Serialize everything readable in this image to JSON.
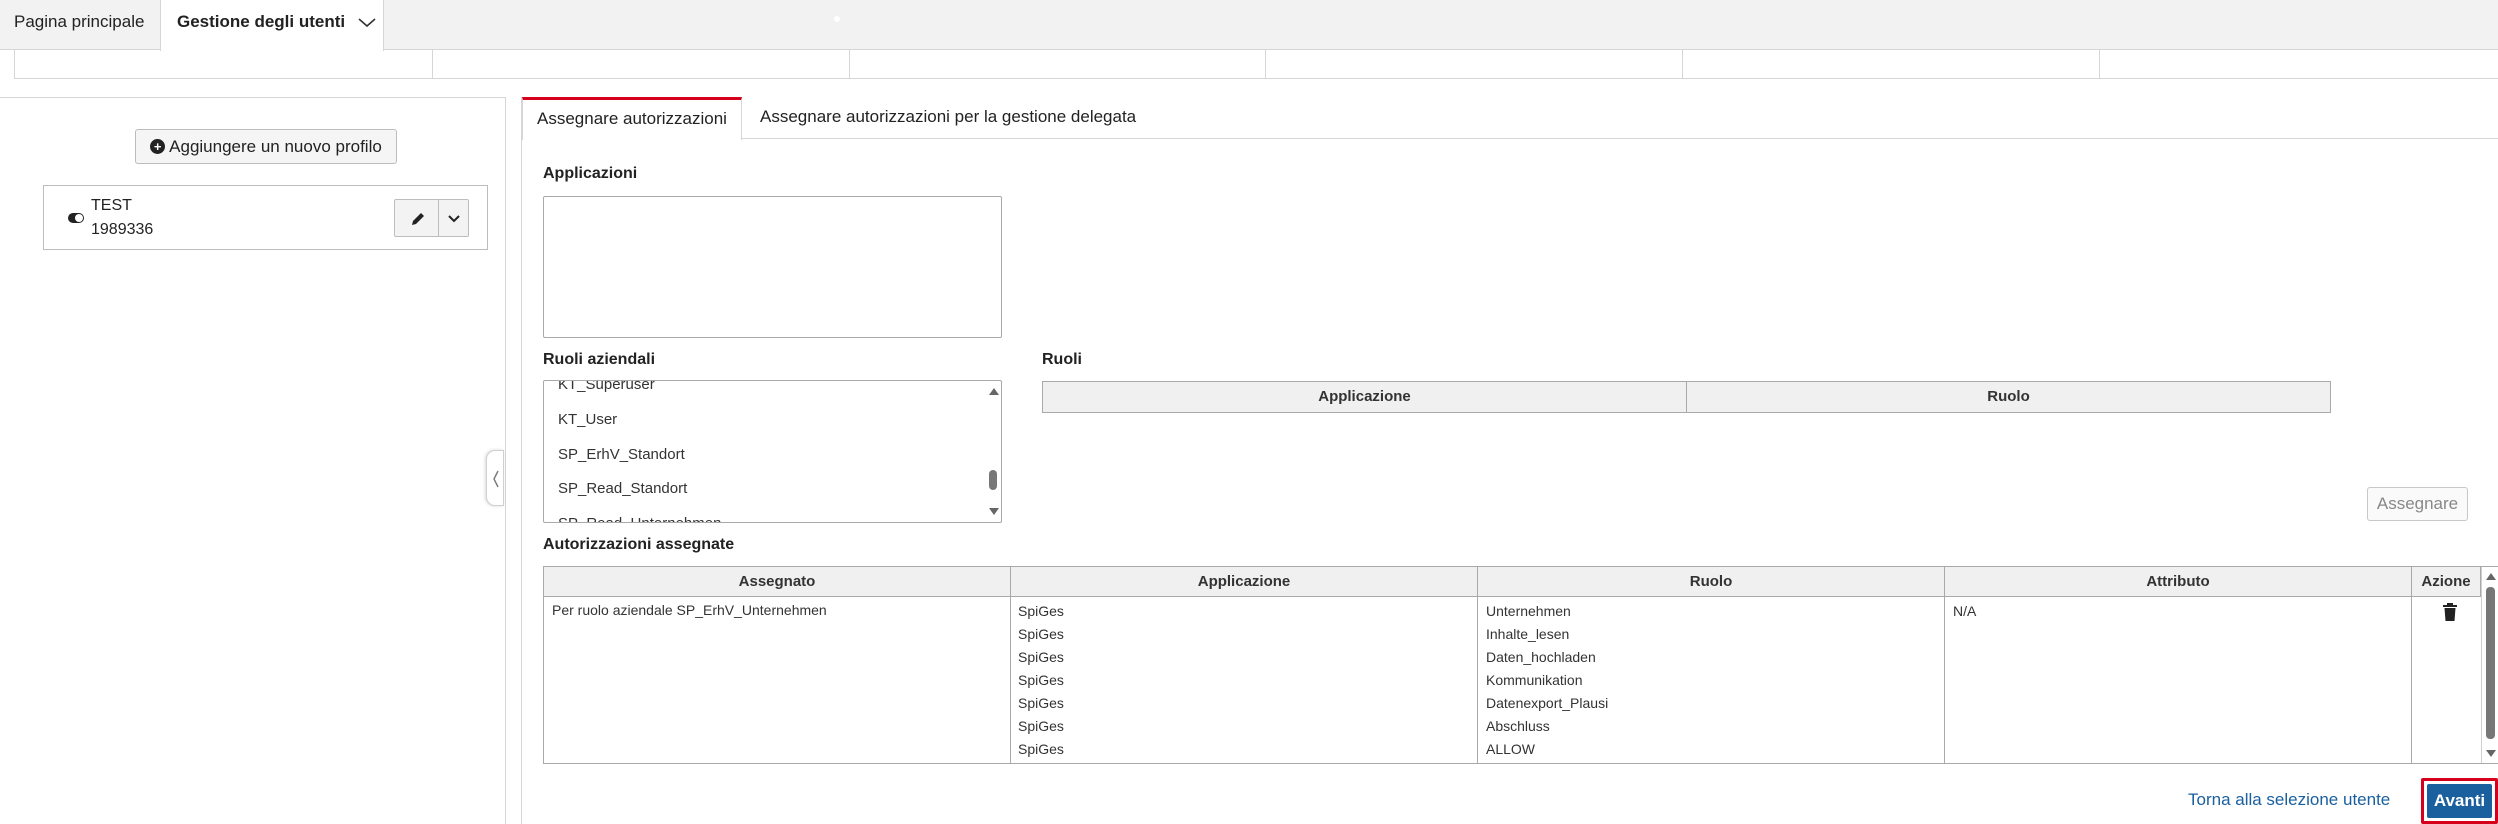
{
  "top_tabs": {
    "home": "Pagina principale",
    "user_management": "Gestione degli utenti"
  },
  "left_panel": {
    "add_profile_label": "Aggiungere un nuovo profilo",
    "profile": {
      "name": "TEST",
      "id": "1989336"
    }
  },
  "content_tabs": {
    "assign": "Assegnare autorizzazioni",
    "assign_delegated": "Assegnare autorizzazioni per la gestione delegata"
  },
  "applications": {
    "label": "Applicazioni"
  },
  "business_roles": {
    "label": "Ruoli aziendali",
    "items": [
      "KT_Superuser",
      "KT_User",
      "SP_ErhV_Standort",
      "SP_Read_Standort",
      "SP_Read_Unternehmen"
    ]
  },
  "roles": {
    "label": "Ruoli",
    "columns": [
      "Applicazione",
      "Ruolo"
    ]
  },
  "assign_button": "Assegnare",
  "assigned": {
    "label": "Autorizzazioni assegnate",
    "columns": [
      "Assegnato",
      "Applicazione",
      "Ruolo",
      "Attributo",
      "Azione"
    ],
    "row": {
      "assigned": "Per ruolo aziendale SP_ErhV_Unternehmen",
      "applications": [
        "SpiGes",
        "SpiGes",
        "SpiGes",
        "SpiGes",
        "SpiGes",
        "SpiGes",
        "SpiGes"
      ],
      "roles": [
        "Unternehmen",
        "Inhalte_lesen",
        "Daten_hochladen",
        "Kommunikation",
        "Datenexport_Plausi",
        "Abschluss",
        "ALLOW"
      ],
      "attribute": "N/A"
    }
  },
  "footer": {
    "back_link": "Torna alla selezione utente",
    "next_button": "Avanti"
  },
  "colors": {
    "accent_red": "#d6001c",
    "primary_blue": "#1a5f9e"
  },
  "icons": [
    "plus-circle-icon",
    "toggle-icon",
    "pencil-icon",
    "chevron-down-icon",
    "collapse-chevron-icon",
    "trash-icon"
  ]
}
